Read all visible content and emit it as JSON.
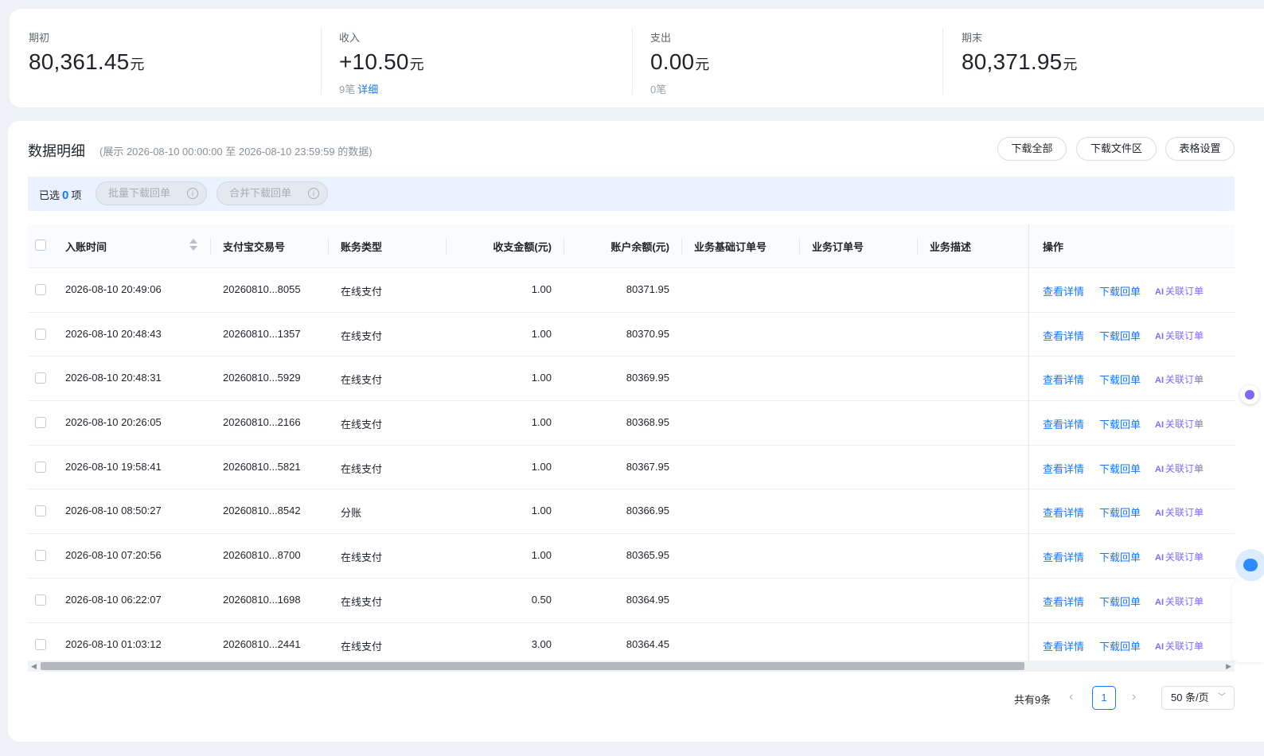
{
  "summary": [
    {
      "label": "期初",
      "value": "80,361.45",
      "unit": "元",
      "sub_count": "",
      "sub_link": ""
    },
    {
      "label": "收入",
      "value": "+10.50",
      "unit": "元",
      "sub_count": "9笔",
      "sub_link": "详细"
    },
    {
      "label": "支出",
      "value": "0.00",
      "unit": "元",
      "sub_count": "0笔",
      "sub_link": ""
    },
    {
      "label": "期末",
      "value": "80,371.95",
      "unit": "元",
      "sub_count": "",
      "sub_link": ""
    }
  ],
  "detail": {
    "title": "数据明细",
    "range": "(展示 2026-08-10 00:00:00 至 2026-08-10 23:59:59 的数据)",
    "buttons": {
      "download_all": "下载全部",
      "download_files": "下载文件区",
      "table_settings": "表格设置"
    }
  },
  "selection": {
    "prefix": "已选",
    "count": "0",
    "suffix": "项",
    "batch_download": "批量下载回单",
    "merge_download": "合并下载回单"
  },
  "table": {
    "headers": {
      "time": "入账时间",
      "trade_no": "支付宝交易号",
      "type": "账务类型",
      "amount": "收支金额(元)",
      "balance": "账户余额(元)",
      "base_order": "业务基础订单号",
      "order": "业务订单号",
      "desc": "业务描述",
      "ops": "操作"
    },
    "actions": {
      "view": "查看详情",
      "download": "下载回单",
      "link": "关联订单",
      "ai_icon": "AI"
    },
    "rows": [
      {
        "time": "2026-08-10 20:49:06",
        "trade_no": "20260810...8055",
        "type": "在线支付",
        "amount": "1.00",
        "balance": "80371.95"
      },
      {
        "time": "2026-08-10 20:48:43",
        "trade_no": "20260810...1357",
        "type": "在线支付",
        "amount": "1.00",
        "balance": "80370.95"
      },
      {
        "time": "2026-08-10 20:48:31",
        "trade_no": "20260810...5929",
        "type": "在线支付",
        "amount": "1.00",
        "balance": "80369.95"
      },
      {
        "time": "2026-08-10 20:26:05",
        "trade_no": "20260810...2166",
        "type": "在线支付",
        "amount": "1.00",
        "balance": "80368.95"
      },
      {
        "time": "2026-08-10 19:58:41",
        "trade_no": "20260810...5821",
        "type": "在线支付",
        "amount": "1.00",
        "balance": "80367.95"
      },
      {
        "time": "2026-08-10 08:50:27",
        "trade_no": "20260810...8542",
        "type": "分账",
        "amount": "1.00",
        "balance": "80366.95"
      },
      {
        "time": "2026-08-10 07:20:56",
        "trade_no": "20260810...8700",
        "type": "在线支付",
        "amount": "1.00",
        "balance": "80365.95"
      },
      {
        "time": "2026-08-10 06:22:07",
        "trade_no": "20260810...1698",
        "type": "在线支付",
        "amount": "0.50",
        "balance": "80364.95"
      },
      {
        "time": "2026-08-10 01:03:12",
        "trade_no": "20260810...2441",
        "type": "在线支付",
        "amount": "3.00",
        "balance": "80364.45"
      }
    ]
  },
  "pagination": {
    "total": "共有9条",
    "current": "1",
    "page_size": "50 条/页"
  },
  "colors": {
    "accent": "#1677ff",
    "ai": "#7b6cf6",
    "selbar": "#eaf2ff"
  }
}
